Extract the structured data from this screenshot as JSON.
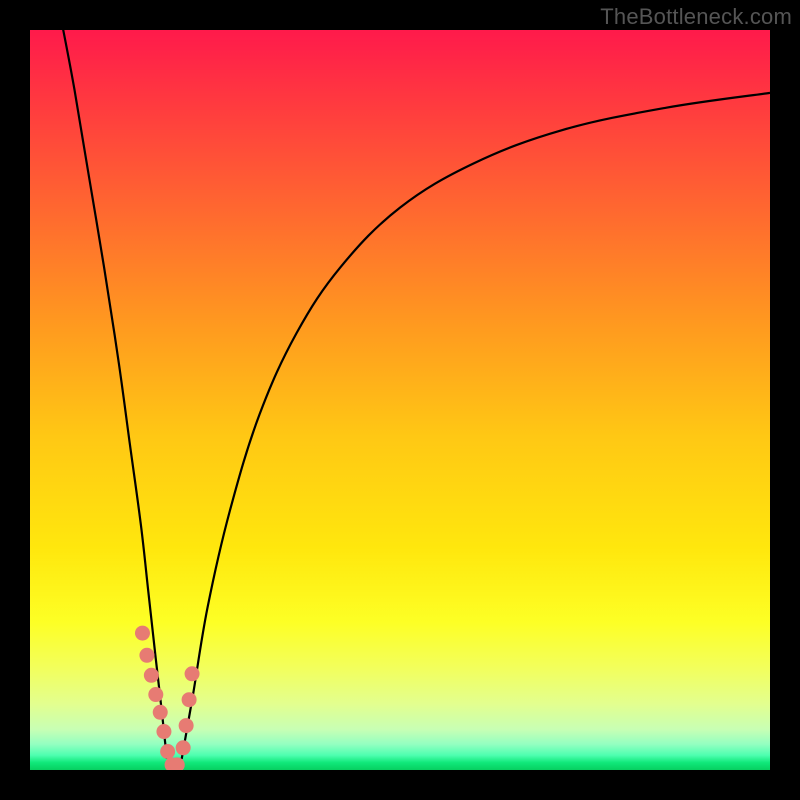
{
  "watermark": {
    "text": "TheBottleneck.com"
  },
  "colors": {
    "frame": "#000000",
    "curve_stroke": "#000000",
    "marker_fill": "#e77b73",
    "gradient_top": "#ff1a4b",
    "gradient_bottom": "#07cf60"
  },
  "chart_data": {
    "type": "line",
    "title": "",
    "xlabel": "",
    "ylabel": "",
    "xlim": [
      0,
      100
    ],
    "ylim": [
      0,
      100
    ],
    "grid": false,
    "legend": false,
    "annotations": [],
    "series": [
      {
        "name": "left_branch",
        "x": [
          4.3,
          6,
          8,
          10,
          12,
          13.5,
          15,
          16,
          17,
          17.8,
          18.5
        ],
        "values": [
          101,
          92,
          80,
          68,
          55,
          44,
          33,
          24,
          15,
          8,
          1.5
        ]
      },
      {
        "name": "right_branch",
        "x": [
          20.5,
          22,
          24,
          27,
          31,
          36,
          42,
          50,
          60,
          72,
          86,
          100
        ],
        "values": [
          1.5,
          10,
          22,
          35,
          48,
          59,
          68,
          76,
          82,
          86.5,
          89.5,
          91.5
        ]
      }
    ],
    "markers": [
      {
        "name": "left_cluster",
        "x": [
          15.2,
          15.8,
          16.4,
          17.0,
          17.6,
          18.1,
          18.6
        ],
        "values": [
          18.5,
          15.5,
          12.8,
          10.2,
          7.8,
          5.2,
          2.5
        ]
      },
      {
        "name": "right_cluster",
        "x": [
          20.7,
          21.1,
          21.5,
          21.9
        ],
        "values": [
          3.0,
          6.0,
          9.5,
          13.0
        ]
      },
      {
        "name": "bottom_pair",
        "x": [
          19.2,
          19.9
        ],
        "values": [
          0.7,
          0.7
        ]
      }
    ]
  }
}
